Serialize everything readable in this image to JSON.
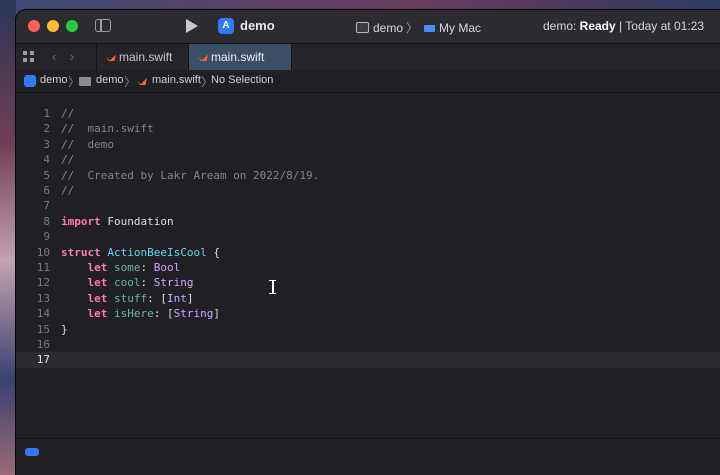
{
  "window": {
    "scheme": "demo",
    "destination": {
      "scheme": "demo",
      "device": "My Mac",
      "separator": "〉"
    },
    "status": {
      "prefix": "demo: ",
      "state": "Ready",
      "rest": " | Today at 01:23"
    }
  },
  "tabs": [
    {
      "label": "main.swift",
      "active": false
    },
    {
      "label": "main.swift",
      "active": true
    }
  ],
  "jumpbar": {
    "project": "demo",
    "group": "demo",
    "file": "main.swift",
    "selection": "No Selection",
    "separator": "〉"
  },
  "editor": {
    "current_line": 17,
    "lines": [
      {
        "n": "1",
        "tokens": [
          {
            "t": "//",
            "c": "comment"
          }
        ]
      },
      {
        "n": "2",
        "tokens": [
          {
            "t": "//  main.swift",
            "c": "comment"
          }
        ]
      },
      {
        "n": "3",
        "tokens": [
          {
            "t": "//  demo",
            "c": "comment"
          }
        ]
      },
      {
        "n": "4",
        "tokens": [
          {
            "t": "//",
            "c": "comment"
          }
        ]
      },
      {
        "n": "5",
        "tokens": [
          {
            "t": "//  Created by Lakr Aream on 2022/8/19.",
            "c": "comment"
          }
        ]
      },
      {
        "n": "6",
        "tokens": [
          {
            "t": "//",
            "c": "comment"
          }
        ]
      },
      {
        "n": "7",
        "tokens": []
      },
      {
        "n": "8",
        "tokens": [
          {
            "t": "import",
            "c": "kw"
          },
          {
            "t": " Foundation",
            "c": "plain"
          }
        ]
      },
      {
        "n": "9",
        "tokens": []
      },
      {
        "n": "10",
        "tokens": [
          {
            "t": "struct",
            "c": "kw"
          },
          {
            "t": " ",
            "c": "plain"
          },
          {
            "t": "ActionBeeIsCool",
            "c": "type"
          },
          {
            "t": " {",
            "c": "plain"
          }
        ]
      },
      {
        "n": "11",
        "tokens": [
          {
            "t": "    ",
            "c": "plain"
          },
          {
            "t": "let",
            "c": "kw"
          },
          {
            "t": " ",
            "c": "plain"
          },
          {
            "t": "some",
            "c": "prop"
          },
          {
            "t": ": ",
            "c": "plain"
          },
          {
            "t": "Bool",
            "c": "builtin"
          }
        ]
      },
      {
        "n": "12",
        "tokens": [
          {
            "t": "    ",
            "c": "plain"
          },
          {
            "t": "let",
            "c": "kw"
          },
          {
            "t": " ",
            "c": "plain"
          },
          {
            "t": "cool",
            "c": "prop"
          },
          {
            "t": ": ",
            "c": "plain"
          },
          {
            "t": "String",
            "c": "builtin"
          }
        ]
      },
      {
        "n": "13",
        "tokens": [
          {
            "t": "    ",
            "c": "plain"
          },
          {
            "t": "let",
            "c": "kw"
          },
          {
            "t": " ",
            "c": "plain"
          },
          {
            "t": "stuff",
            "c": "prop"
          },
          {
            "t": ": [",
            "c": "plain"
          },
          {
            "t": "Int",
            "c": "builtin"
          },
          {
            "t": "]",
            "c": "plain"
          }
        ]
      },
      {
        "n": "14",
        "tokens": [
          {
            "t": "    ",
            "c": "plain"
          },
          {
            "t": "let",
            "c": "kw"
          },
          {
            "t": " ",
            "c": "plain"
          },
          {
            "t": "isHere",
            "c": "prop"
          },
          {
            "t": ": [",
            "c": "plain"
          },
          {
            "t": "String",
            "c": "builtin"
          },
          {
            "t": "]",
            "c": "plain"
          }
        ]
      },
      {
        "n": "15",
        "tokens": [
          {
            "t": "}",
            "c": "plain"
          }
        ]
      },
      {
        "n": "16",
        "tokens": []
      },
      {
        "n": "17",
        "tokens": []
      }
    ]
  },
  "colors": {
    "comment": "#7b8794",
    "keyword": "#ff7ab2",
    "type": "#5dd8ff",
    "property": "#67b7a4",
    "builtin": "#d0a8ff",
    "accent": "#2f7bf5"
  }
}
